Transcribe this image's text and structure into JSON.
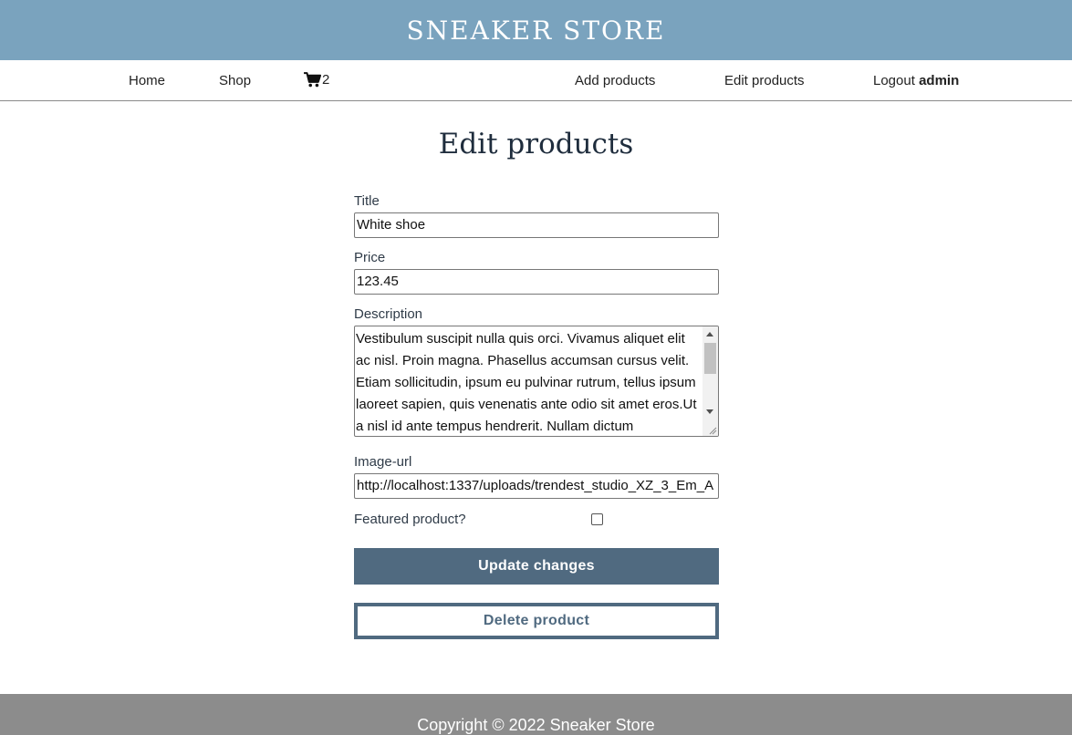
{
  "header": {
    "brand": "SNEAKER STORE"
  },
  "nav": {
    "home": "Home",
    "shop": "Shop",
    "cart_icon": "cart-icon",
    "cart_count": "2",
    "add_products": "Add products",
    "edit_products": "Edit products",
    "logout_label": "Logout",
    "logout_user": "admin"
  },
  "main": {
    "title": "Edit products",
    "form": {
      "title_label": "Title",
      "title_value": "White shoe",
      "price_label": "Price",
      "price_value": "123.45",
      "description_label": "Description",
      "description_value": "Vestibulum suscipit nulla quis orci. Vivamus aliquet elit ac nisl. Proin magna. Phasellus accumsan cursus velit. Etiam sollicitudin, ipsum eu pulvinar rutrum, tellus ipsum laoreet sapien, quis venenatis ante odio sit amet eros.Ut a nisl id ante tempus hendrerit. Nullam dictum",
      "image_label": "Image-url",
      "image_value": "http://localhost:1337/uploads/trendest_studio_XZ_3_Em_A",
      "featured_label": "Featured product?",
      "featured_checked": false,
      "update_button": "Update changes",
      "delete_button": "Delete product"
    }
  },
  "footer": {
    "copyright": "Copyright © 2022 Sneaker Store"
  },
  "colors": {
    "header_bg": "#7aa3be",
    "button_primary": "#506a80",
    "footer_bg": "#8c8c8c"
  }
}
